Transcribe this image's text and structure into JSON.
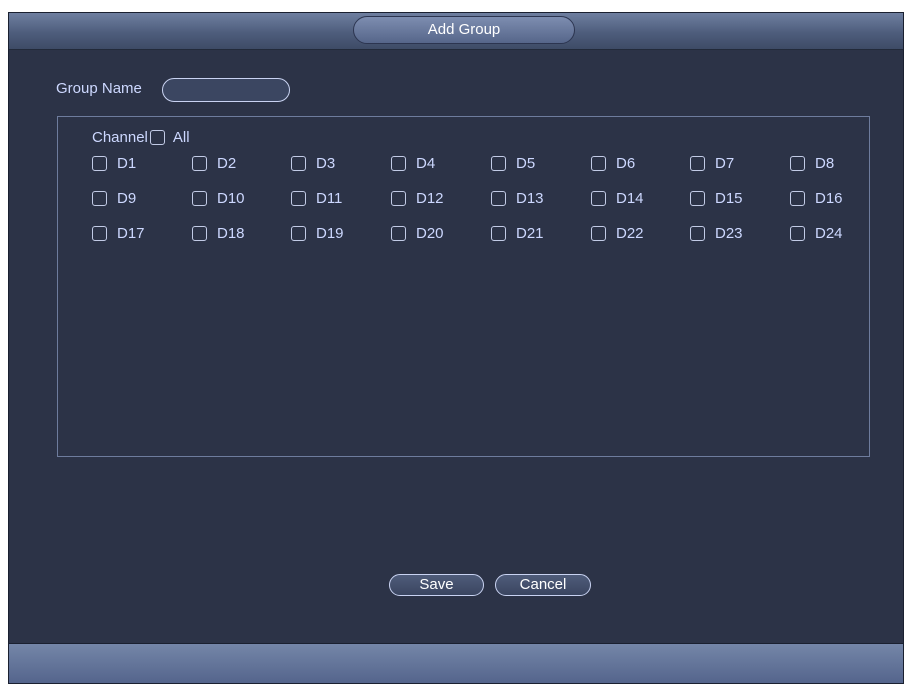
{
  "dialog": {
    "title": "Add Group",
    "group_name_label": "Group Name",
    "group_name_value": "",
    "channel_label": "Channel",
    "all_label": "All",
    "channels": [
      "D1",
      "D2",
      "D3",
      "D4",
      "D5",
      "D6",
      "D7",
      "D8",
      "D9",
      "D10",
      "D11",
      "D12",
      "D13",
      "D14",
      "D15",
      "D16",
      "D17",
      "D18",
      "D19",
      "D20",
      "D21",
      "D22",
      "D23",
      "D24"
    ],
    "save_label": "Save",
    "cancel_label": "Cancel"
  },
  "colors": {
    "background": "#2c3347",
    "text": "#cdd8ff",
    "titlebar": "#5b6a8a"
  }
}
